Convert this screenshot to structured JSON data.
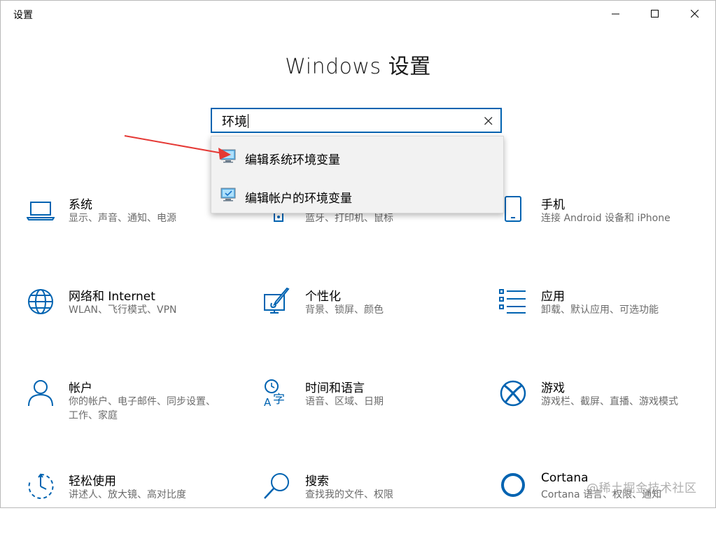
{
  "window": {
    "title": "设置"
  },
  "heading": "Windows 设置",
  "search": {
    "value": "环境"
  },
  "dropdown": {
    "items": [
      {
        "label": "编辑系统环境变量"
      },
      {
        "label": "编辑帐户的环境变量"
      }
    ]
  },
  "tiles": {
    "system": {
      "name": "系统",
      "desc": "显示、声音、通知、电源"
    },
    "devices": {
      "desc": "蓝牙、打印机、鼠标"
    },
    "phone": {
      "name": "手机",
      "desc": "连接 Android 设备和 iPhone"
    },
    "network": {
      "name": "网络和 Internet",
      "desc": "WLAN、飞行模式、VPN"
    },
    "personalization": {
      "name": "个性化",
      "desc": "背景、锁屏、颜色"
    },
    "apps": {
      "name": "应用",
      "desc": "卸载、默认应用、可选功能"
    },
    "accounts": {
      "name": "帐户",
      "desc": "你的帐户、电子邮件、同步设置、工作、家庭"
    },
    "time": {
      "name": "时间和语言",
      "desc": "语音、区域、日期"
    },
    "gaming": {
      "name": "游戏",
      "desc": "游戏栏、截屏、直播、游戏模式"
    },
    "ease": {
      "name": "轻松使用",
      "desc": "讲述人、放大镜、高对比度"
    },
    "searchtile": {
      "name": "搜索",
      "desc": "查找我的文件、权限"
    },
    "cortana": {
      "name": "Cortana",
      "desc": "Cortana 语言、权限、通知"
    }
  },
  "watermark": "@稀土掘金技术社区",
  "colors": {
    "accent": "#0063b1",
    "arrow": "#e53935"
  }
}
